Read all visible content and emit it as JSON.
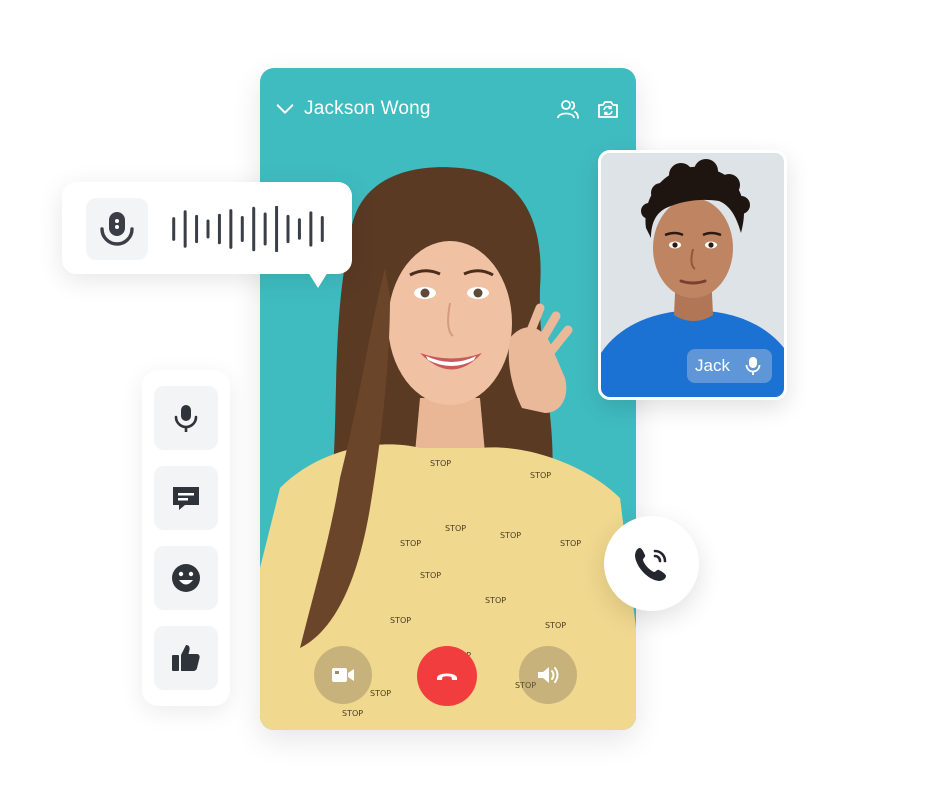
{
  "call": {
    "caller_name": "Jackson Wong",
    "background_color": "#3fbcc0",
    "header_icons": [
      "chevron-down-icon",
      "participants-icon",
      "switch-camera-icon"
    ],
    "controls": [
      {
        "name": "camera",
        "icon": "video-camera-icon"
      },
      {
        "name": "end-call",
        "icon": "hang-up-icon",
        "color": "#f13d3d"
      },
      {
        "name": "speaker",
        "icon": "speaker-icon"
      }
    ]
  },
  "pip": {
    "name": "Jack",
    "icon": "microphone-icon"
  },
  "voice_message": {
    "icon": "microphone-icon",
    "waveform": [
      0.45,
      0.75,
      0.55,
      0.35,
      0.6,
      0.8,
      0.5,
      0.9,
      0.65,
      0.95,
      0.55,
      0.4,
      0.7,
      0.5
    ]
  },
  "toolbar": {
    "items": [
      {
        "name": "microphone",
        "icon": "microphone-icon"
      },
      {
        "name": "chat",
        "icon": "chat-icon"
      },
      {
        "name": "emoji",
        "icon": "emoji-icon"
      },
      {
        "name": "like",
        "icon": "thumbs-up-icon"
      }
    ]
  },
  "phone_fab": {
    "icon": "phone-ringing-icon"
  }
}
